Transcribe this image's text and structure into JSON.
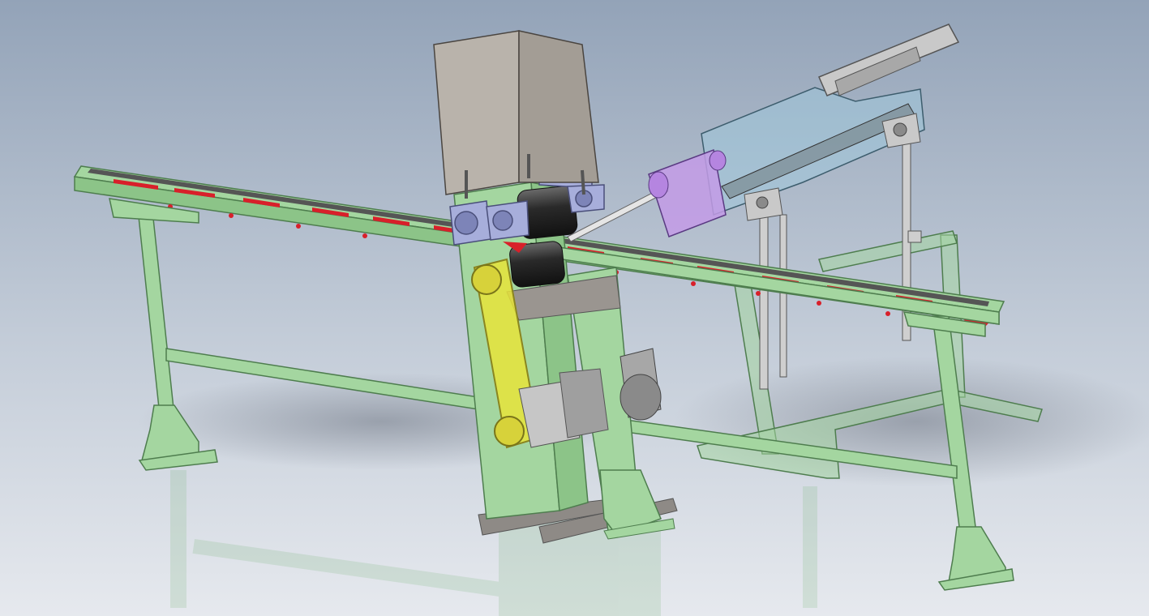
{
  "scene": {
    "kind": "cad-render",
    "subject": "conveyor-feeding-machine-assembly",
    "colors": {
      "background_top": "#93a3b8",
      "background_bottom": "#e6e9ee",
      "frame_green": "#a4d6a0",
      "frame_green_dark": "#4e7d4e",
      "conveyor_red": "#d8202a",
      "motor_box": "#b9b3ab",
      "belt_yellow": "#e7e43a",
      "roller_dark": "#333333",
      "cylinder_purple": "#c39be6",
      "glass_blue": "#9ecbe0",
      "bracket_blue": "#a7aedb",
      "gray_metal": "#8a8a8a"
    }
  }
}
